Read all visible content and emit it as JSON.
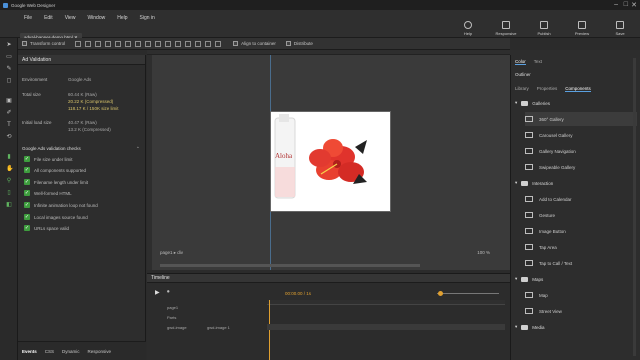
{
  "app": {
    "title": "Google Web Designer"
  },
  "menu": [
    "File",
    "Edit",
    "View",
    "Window",
    "Help",
    "Sign in"
  ],
  "document_tab": "adval-banner-demo.html ✕",
  "top_buttons": [
    {
      "label": "Help",
      "icon": "help-icon"
    },
    {
      "label": "Responsive",
      "icon": "responsive-icon"
    },
    {
      "label": "Publish",
      "icon": "publish-icon"
    },
    {
      "label": "Preview",
      "icon": "preview-icon"
    },
    {
      "label": "Save",
      "icon": "save-icon"
    }
  ],
  "toolbar": {
    "transform_control": "Transform control",
    "align_to_container": "Align to container",
    "distribute": "Distribute"
  },
  "ad_validation": {
    "header": "Ad Validation",
    "environment_label": "Environment",
    "environment_value": "Google Ads",
    "total_size_label": "Total size",
    "total_size_values": [
      "60.44 K (Raw)",
      "20.22 K (Compressed)",
      "118.17 K / 150K size limit"
    ],
    "initial_load_label": "Initial load size",
    "initial_load_values": [
      "40.47 K (Raw)",
      "13.2 K (Compressed)"
    ],
    "checks_header": "Google Ads validation checks",
    "checks": [
      "File size under limit",
      "All components supported",
      "Filename length under limit",
      "Well-formed HTML",
      "Infinite animation loop not found",
      "Local images source found",
      "URLs space valid"
    ]
  },
  "bottom_tabs": [
    "Events",
    "CSS",
    "Dynamic",
    "Responsive"
  ],
  "stage": {
    "page_label": "page1 ▸ div",
    "zoom": "100 %",
    "product_text": "Aloha"
  },
  "timeline": {
    "header": "Timeline",
    "time": "00:00.00 / 1s",
    "rows": [
      "page1",
      "Parts",
      "gwd-image",
      "gwd-image 1"
    ]
  },
  "right_panel": {
    "top_tabs": [
      "Color",
      "Text"
    ],
    "outliner": "Outliner",
    "tabs": [
      "Library",
      "Properties",
      "Components"
    ],
    "active_tab": "Components",
    "categories": [
      {
        "name": "Galleries",
        "items": [
          "360° Gallery",
          "Carousel Gallery",
          "Gallery Navigation",
          "Swipeable Gallery"
        ]
      },
      {
        "name": "Interaction",
        "items": [
          "Add to Calendar",
          "Gesture",
          "Image Button",
          "Tap Area",
          "Tap to Call / Text"
        ]
      },
      {
        "name": "Maps",
        "items": [
          "Map",
          "Street View"
        ]
      },
      {
        "name": "Media",
        "items": []
      }
    ],
    "selected_item": "360° Gallery"
  },
  "colors": {
    "accent": "#5aa0e0",
    "check_green": "#3e9d3e",
    "flower_red": "#e0332c"
  }
}
